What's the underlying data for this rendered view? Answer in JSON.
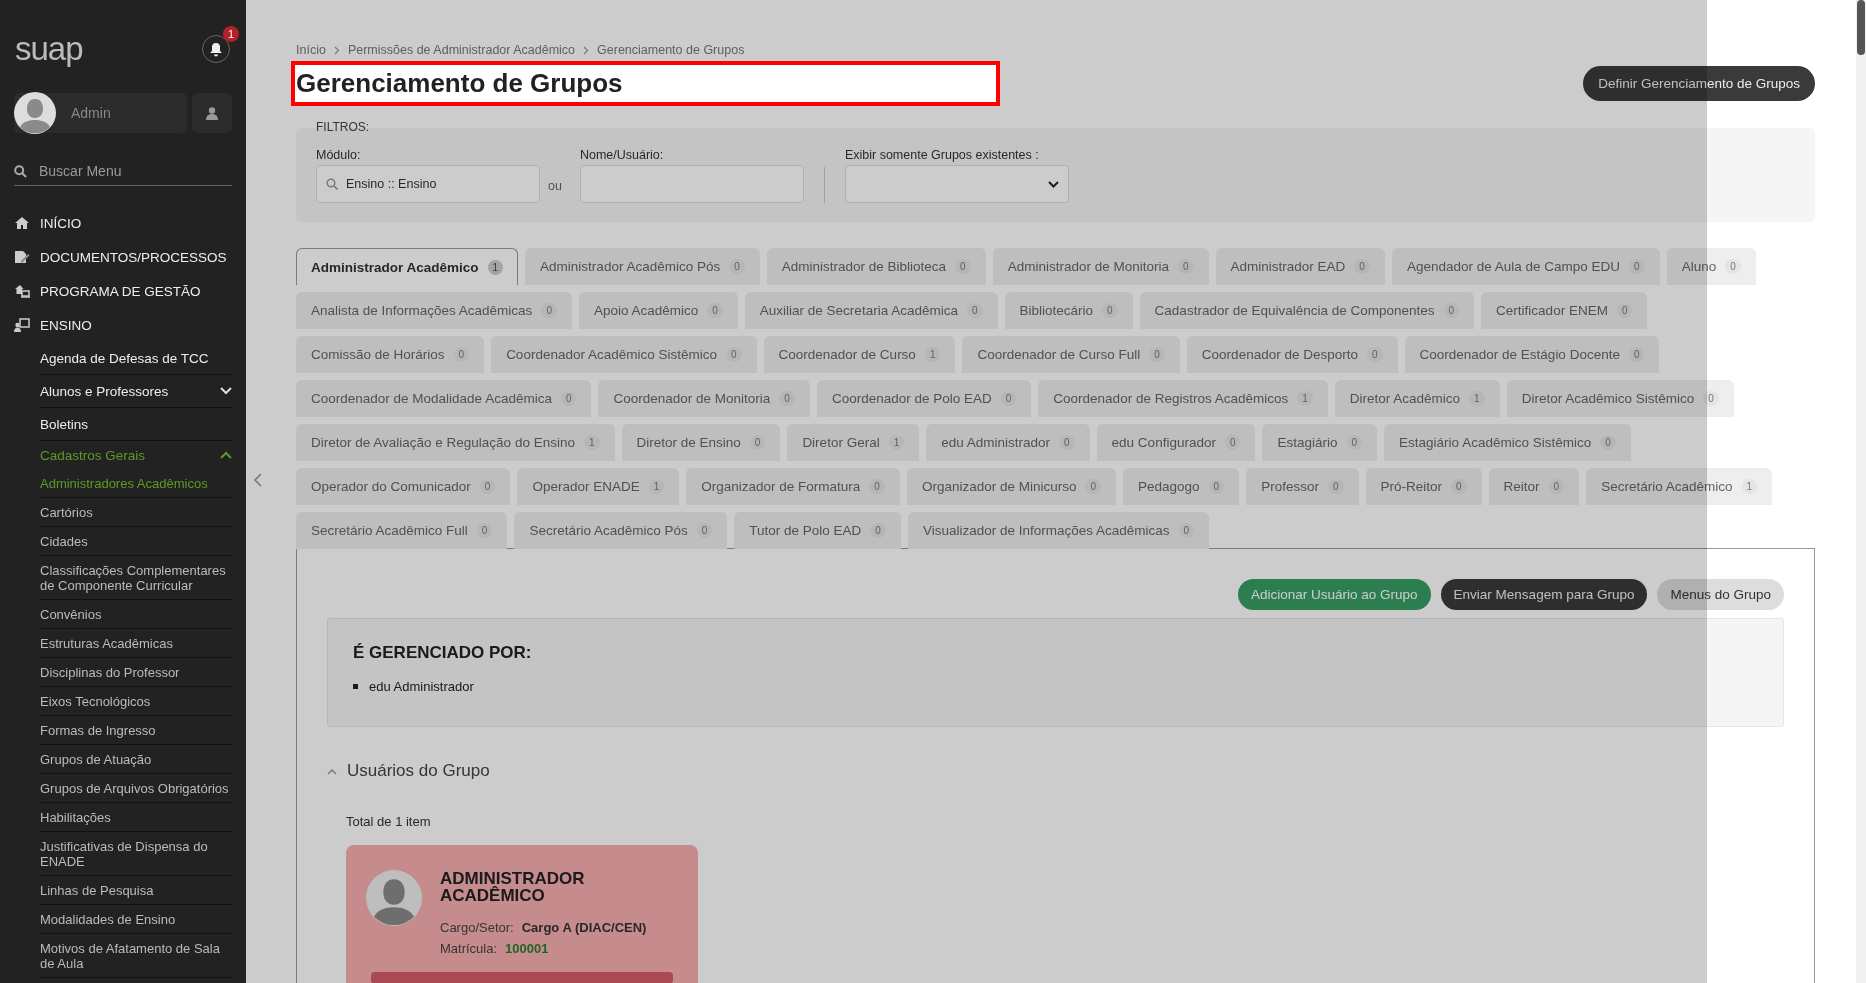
{
  "sidebar": {
    "logo": "suap",
    "notifications": "1",
    "user": "Admin",
    "search": {
      "placeholder": "Buscar Menu"
    },
    "menu": [
      {
        "label": "INÍCIO"
      },
      {
        "label": "DOCUMENTOS/PROCESSOS"
      },
      {
        "label": "PROGRAMA DE GESTÃO"
      },
      {
        "label": "ENSINO",
        "children": [
          {
            "label": "Agenda de Defesas de TCC"
          },
          {
            "label": "Alunos e Professores",
            "expanded": false
          },
          {
            "label": "Boletins"
          },
          {
            "label": "Cadastros Gerais",
            "expanded": true,
            "children": [
              {
                "label": "Administradores Acadêmicos",
                "selected": true
              },
              {
                "label": "Cartórios",
                "selected": false
              },
              {
                "label": "Cidades",
                "selected": false
              },
              {
                "label": "Classificações Complementares de Componente Curricular",
                "selected": false
              },
              {
                "label": "Convênios",
                "selected": false
              },
              {
                "label": "Estruturas Acadêmicas",
                "selected": false
              },
              {
                "label": "Disciplinas do Professor",
                "selected": false
              },
              {
                "label": "Eixos Tecnológicos",
                "selected": false
              },
              {
                "label": "Formas de Ingresso",
                "selected": false
              },
              {
                "label": "Grupos de Atuação",
                "selected": false
              },
              {
                "label": "Grupos de Arquivos Obrigatórios",
                "selected": false
              },
              {
                "label": "Habilitações",
                "selected": false
              },
              {
                "label": "Justificativas de Dispensa do ENADE",
                "selected": false
              },
              {
                "label": "Linhas de Pesquisa",
                "selected": false
              },
              {
                "label": "Modalidades de Ensino",
                "selected": false
              },
              {
                "label": "Motivos de Afatamento de Sala de Aula",
                "selected": false
              }
            ]
          }
        ]
      }
    ]
  },
  "breadcrumb": [
    "Início",
    "Permissões de Administrador Acadêmico",
    "Gerenciamento de Grupos"
  ],
  "title": "Gerenciamento de Grupos",
  "action_button": "Definir Gerenciamento de Grupos",
  "filters": {
    "legend": "FILTROS:",
    "module_label": "Módulo:",
    "module_value": "Ensino :: Ensino",
    "or": "ou",
    "name_label": "Nome/Usuário:",
    "existing_label": "Exibir somente Grupos existentes :"
  },
  "tabs": [
    {
      "label": "Administrador Acadêmico",
      "count": "1",
      "selected": true
    },
    {
      "label": "Administrador Acadêmico Pós",
      "count": "0",
      "selected": false
    },
    {
      "label": "Administrador de Biblioteca",
      "count": "0",
      "selected": false
    },
    {
      "label": "Administrador de Monitoria",
      "count": "0",
      "selected": false
    },
    {
      "label": "Administrador EAD",
      "count": "0",
      "selected": false
    },
    {
      "label": "Agendador de Aula de Campo EDU",
      "count": "0",
      "selected": false
    },
    {
      "label": "Aluno",
      "count": "0",
      "selected": false
    },
    {
      "label": "Analista de Informações Acadêmicas",
      "count": "0",
      "selected": false
    },
    {
      "label": "Apoio Acadêmico",
      "count": "0",
      "selected": false
    },
    {
      "label": "Auxiliar de Secretaria Acadêmica",
      "count": "0",
      "selected": false
    },
    {
      "label": "Bibliotecário",
      "count": "0",
      "selected": false
    },
    {
      "label": "Cadastrador de Equivalência de Componentes",
      "count": "0",
      "selected": false
    },
    {
      "label": "Certificador ENEM",
      "count": "0",
      "selected": false
    },
    {
      "label": "Comissão de Horários",
      "count": "0",
      "selected": false
    },
    {
      "label": "Coordenador Acadêmico Sistêmico",
      "count": "0",
      "selected": false
    },
    {
      "label": "Coordenador de Curso",
      "count": "1",
      "selected": false
    },
    {
      "label": "Coordenador de Curso Full",
      "count": "0",
      "selected": false
    },
    {
      "label": "Coordenador de Desporto",
      "count": "0",
      "selected": false
    },
    {
      "label": "Coordenador de Estágio Docente",
      "count": "0",
      "selected": false
    },
    {
      "label": "Coordenador de Modalidade Acadêmica",
      "count": "0",
      "selected": false
    },
    {
      "label": "Coordenador de Monitoria",
      "count": "0",
      "selected": false
    },
    {
      "label": "Coordenador de Polo EAD",
      "count": "0",
      "selected": false
    },
    {
      "label": "Coordenador de Registros Acadêmicos",
      "count": "1",
      "selected": false
    },
    {
      "label": "Diretor Acadêmico",
      "count": "1",
      "selected": false
    },
    {
      "label": "Diretor Acadêmico Sistêmico",
      "count": "0",
      "selected": false
    },
    {
      "label": "Diretor de Avaliação e Regulação do Ensino",
      "count": "1",
      "selected": false
    },
    {
      "label": "Diretor de Ensino",
      "count": "0",
      "selected": false
    },
    {
      "label": "Diretor Geral",
      "count": "1",
      "selected": false
    },
    {
      "label": "edu Administrador",
      "count": "0",
      "selected": false
    },
    {
      "label": "edu Configurador",
      "count": "0",
      "selected": false
    },
    {
      "label": "Estagiário",
      "count": "0",
      "selected": false
    },
    {
      "label": "Estagiário Acadêmico Sistêmico",
      "count": "0",
      "selected": false
    },
    {
      "label": "Operador do Comunicador",
      "count": "0",
      "selected": false
    },
    {
      "label": "Operador ENADE",
      "count": "1",
      "selected": false
    },
    {
      "label": "Organizador de Formatura",
      "count": "0",
      "selected": false
    },
    {
      "label": "Organizador de Minicurso",
      "count": "0",
      "selected": false
    },
    {
      "label": "Pedagogo",
      "count": "0",
      "selected": false
    },
    {
      "label": "Professor",
      "count": "0",
      "selected": false
    },
    {
      "label": "Pró-Reitor",
      "count": "0",
      "selected": false
    },
    {
      "label": "Reitor",
      "count": "0",
      "selected": false
    },
    {
      "label": "Secretário Acadêmico",
      "count": "1",
      "selected": false
    },
    {
      "label": "Secretário Acadêmico Full",
      "count": "0",
      "selected": false
    },
    {
      "label": "Secretário Acadêmico Pós",
      "count": "0",
      "selected": false
    },
    {
      "label": "Tutor de Polo EAD",
      "count": "0",
      "selected": false
    },
    {
      "label": "Visualizador de Informações Acadêmicas",
      "count": "0",
      "selected": false
    }
  ],
  "panel": {
    "buttons": [
      {
        "label": "Adicionar Usuário ao Grupo",
        "kind": "success"
      },
      {
        "label": "Enviar Mensagem para Grupo",
        "kind": "dark"
      },
      {
        "label": "Menus do Grupo",
        "kind": "light"
      }
    ],
    "managed_by": {
      "title": "É GERENCIADO POR:",
      "items": [
        "edu Administrador"
      ]
    },
    "users": {
      "title": "Usuários do Grupo",
      "expanded": true,
      "total": "Total de 1 item",
      "cards": [
        {
          "name": "ADMINISTRADOR ACADÊMICO",
          "fields": [
            {
              "label": "Cargo/Setor:",
              "value": "Cargo A (DIAC/CEN)",
              "kind": "text"
            },
            {
              "label": "Matrícula:",
              "value": "100001",
              "kind": "link"
            }
          ]
        }
      ]
    }
  }
}
